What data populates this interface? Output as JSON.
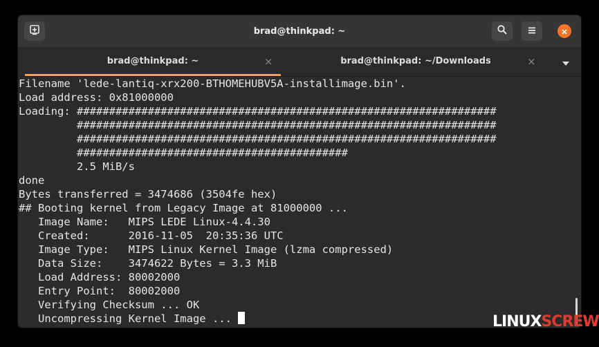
{
  "window": {
    "title": "brad@thinkpad: ~"
  },
  "icons": {
    "new_tab": "new-tab-icon",
    "search": "search-icon",
    "menu": "hamburger-menu-icon",
    "close": "close-icon",
    "tab_close": "×",
    "dropdown": "chevron-down-icon"
  },
  "colors": {
    "accent": "#f3a446",
    "close_button": "#f37329",
    "terminal_bg": "#2b2b2b",
    "terminal_fg": "#e6e6e6",
    "watermark_red": "#e03a2f"
  },
  "tabs": [
    {
      "label": "brad@thinkpad: ~",
      "active": true
    },
    {
      "label": "brad@thinkpad: ~/Downloads",
      "active": false
    }
  ],
  "terminal": {
    "lines": [
      "Filename 'lede-lantiq-xrx200-BTHOMEHUBV5A-installimage.bin'.",
      "Load address: 0x81000000",
      "Loading: #################################################################",
      "         #################################################################",
      "         #################################################################",
      "         ##########################################",
      "         2.5 MiB/s",
      "done",
      "Bytes transferred = 3474686 (3504fe hex)",
      "## Booting kernel from Legacy Image at 81000000 ...",
      "   Image Name:   MIPS LEDE Linux-4.4.30",
      "   Created:      2016-11-05  20:35:36 UTC",
      "   Image Type:   MIPS Linux Kernel Image (lzma compressed)",
      "   Data Size:    3474622 Bytes = 3.3 MiB",
      "   Load Address: 80002000",
      "   Entry Point:  80002000",
      "   Verifying Checksum ... OK",
      "   Uncompressing Kernel Image ... "
    ]
  },
  "watermark": {
    "part1": "LINUX",
    "part2": "SCREW"
  }
}
